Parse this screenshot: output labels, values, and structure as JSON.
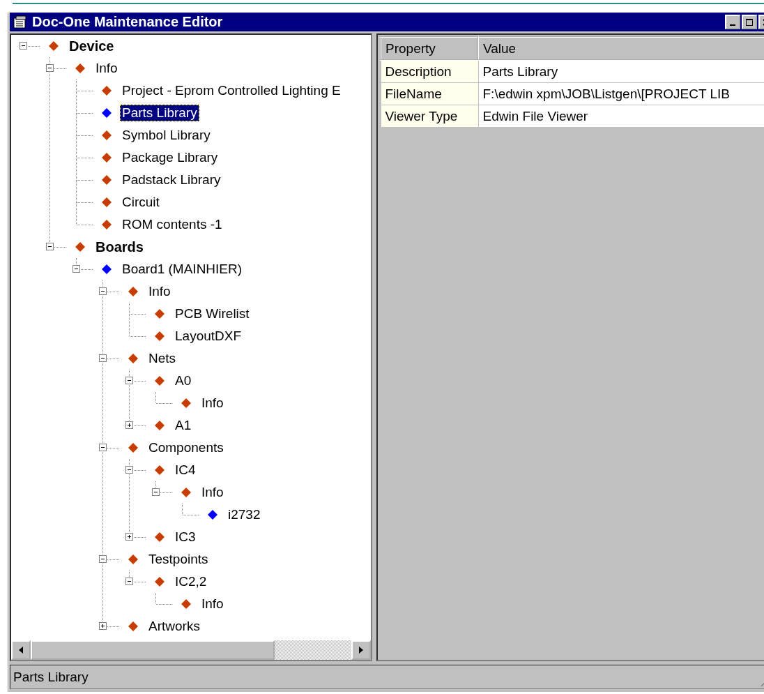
{
  "window": {
    "title": "Doc-One Maintenance Editor"
  },
  "tree": [
    {
      "label": "Device",
      "kind": "heading",
      "color": "#c83c00",
      "selected": false,
      "expanded": true,
      "children": [
        {
          "label": "Info",
          "kind": "node",
          "color": "#c83c00",
          "selected": false,
          "expanded": true,
          "children": [
            {
              "label": "Project - Eprom Controlled Lighting E",
              "kind": "node",
              "color": "#c83c00",
              "selected": false
            },
            {
              "label": "Parts Library",
              "kind": "node",
              "color": "#0000ff",
              "selected": true
            },
            {
              "label": "Symbol Library",
              "kind": "node",
              "color": "#c83c00",
              "selected": false
            },
            {
              "label": "Package Library",
              "kind": "node",
              "color": "#c83c00",
              "selected": false
            },
            {
              "label": "Padstack Library",
              "kind": "node",
              "color": "#c83c00",
              "selected": false
            },
            {
              "label": "Circuit",
              "kind": "node",
              "color": "#c83c00",
              "selected": false
            },
            {
              "label": "ROM contents -1",
              "kind": "node",
              "color": "#c83c00",
              "selected": false
            }
          ]
        },
        {
          "label": "Boards",
          "kind": "heading",
          "color": "#c83c00",
          "selected": false,
          "expanded": true,
          "children": [
            {
              "label": "Board1 (MAINHIER)",
              "kind": "node",
              "color": "#0000ff",
              "selected": false,
              "expanded": true,
              "children": [
                {
                  "label": "Info",
                  "kind": "node",
                  "color": "#c83c00",
                  "selected": false,
                  "expanded": true,
                  "children": [
                    {
                      "label": "PCB Wirelist",
                      "kind": "node",
                      "color": "#c83c00",
                      "selected": false
                    },
                    {
                      "label": "LayoutDXF",
                      "kind": "node",
                      "color": "#c83c00",
                      "selected": false
                    }
                  ]
                },
                {
                  "label": "Nets",
                  "kind": "node",
                  "color": "#c83c00",
                  "selected": false,
                  "expanded": true,
                  "children": [
                    {
                      "label": "A0",
                      "kind": "node",
                      "color": "#c83c00",
                      "selected": false,
                      "expanded": true,
                      "children": [
                        {
                          "label": "Info",
                          "kind": "node",
                          "color": "#c83c00",
                          "selected": false
                        }
                      ]
                    },
                    {
                      "label": "A1",
                      "kind": "node",
                      "color": "#c83c00",
                      "selected": false,
                      "expanded": false
                    }
                  ]
                },
                {
                  "label": "Components",
                  "kind": "node",
                  "color": "#c83c00",
                  "selected": false,
                  "expanded": true,
                  "children": [
                    {
                      "label": "IC4",
                      "kind": "node",
                      "color": "#c83c00",
                      "selected": false,
                      "expanded": true,
                      "children": [
                        {
                          "label": "Info",
                          "kind": "node",
                          "color": "#c83c00",
                          "selected": false,
                          "expanded": true,
                          "children": [
                            {
                              "label": "i2732",
                              "kind": "node",
                              "color": "#0000ff",
                              "selected": false
                            }
                          ]
                        }
                      ]
                    },
                    {
                      "label": "IC3",
                      "kind": "node",
                      "color": "#c83c00",
                      "selected": false,
                      "expanded": false
                    }
                  ]
                },
                {
                  "label": "Testpoints",
                  "kind": "node",
                  "color": "#c83c00",
                  "selected": false,
                  "expanded": true,
                  "children": [
                    {
                      "label": "IC2,2",
                      "kind": "node",
                      "color": "#c83c00",
                      "selected": false,
                      "expanded": true,
                      "children": [
                        {
                          "label": "Info",
                          "kind": "node",
                          "color": "#c83c00",
                          "selected": false
                        }
                      ]
                    }
                  ]
                },
                {
                  "label": "Artworks",
                  "kind": "node",
                  "color": "#c83c00",
                  "selected": false,
                  "expanded": false
                }
              ]
            }
          ]
        }
      ]
    }
  ],
  "properties": {
    "columns": [
      "Property",
      "Value"
    ],
    "rows": [
      {
        "property": "Description",
        "value": "Parts Library"
      },
      {
        "property": "FileName",
        "value": "F:\\edwin xpm\\JOB\\Listgen\\[PROJECT LIB"
      },
      {
        "property": "Viewer Type",
        "value": "Edwin File Viewer"
      }
    ]
  },
  "status_bar": "Parts Library"
}
